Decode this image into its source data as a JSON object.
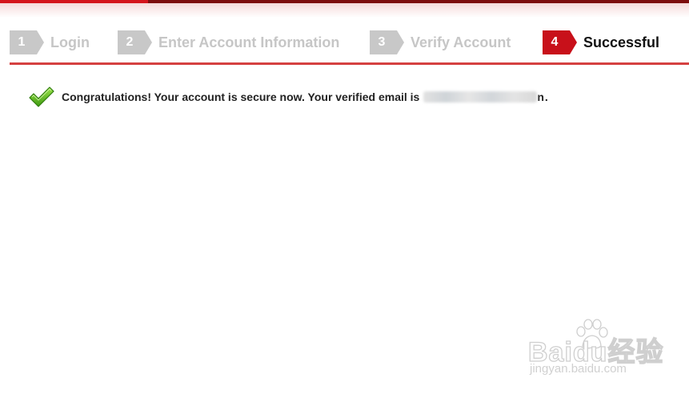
{
  "steps": [
    {
      "number": "1",
      "label": "Login",
      "active": false
    },
    {
      "number": "2",
      "label": "Enter Account Information",
      "active": false
    },
    {
      "number": "3",
      "label": "Verify Account",
      "active": false
    },
    {
      "number": "4",
      "label": "Successful",
      "active": true
    }
  ],
  "message": {
    "icon": "checkmark-icon",
    "text": "Congratulations! Your account is secure now. Your verified email is",
    "email_visible_suffix": "n",
    "end_punct": "."
  },
  "watermark": {
    "brand": "Baidu经验",
    "url": "jingyan.baidu.com",
    "icon": "paw-icon"
  },
  "colors": {
    "accent": "#c8101a",
    "inactive_step": "#c8c8c8",
    "divider": "#d54040",
    "top_bar": "#7c0d0d"
  }
}
